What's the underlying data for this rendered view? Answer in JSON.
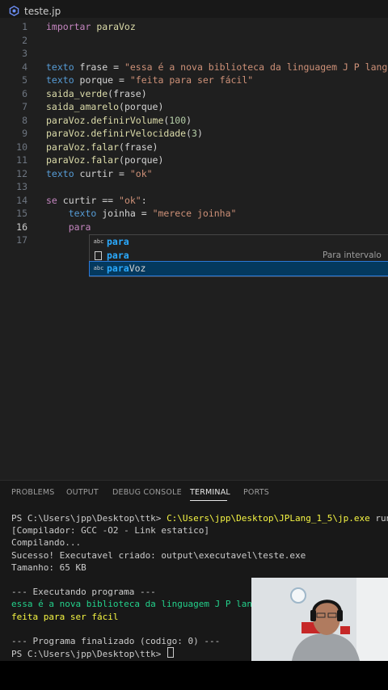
{
  "tab": {
    "title": "teste.jp",
    "icon": "file-gear-icon"
  },
  "editor": {
    "active_line": 16,
    "lines": [
      {
        "n": "1",
        "tokens": [
          {
            "t": "importar",
            "c": "kw"
          },
          {
            "t": " paraVoz",
            "c": "fn"
          }
        ]
      },
      {
        "n": "2",
        "tokens": []
      },
      {
        "n": "3",
        "tokens": []
      },
      {
        "n": "4",
        "tokens": [
          {
            "t": "texto",
            "c": "ty"
          },
          {
            "t": " frase = ",
            "c": "vr"
          },
          {
            "t": "\"essa é a nova biblioteca da linguagem J P lang\"",
            "c": "st"
          }
        ]
      },
      {
        "n": "5",
        "tokens": [
          {
            "t": "texto",
            "c": "ty"
          },
          {
            "t": " porque = ",
            "c": "vr"
          },
          {
            "t": "\"feita para ser fácil\"",
            "c": "st"
          }
        ]
      },
      {
        "n": "6",
        "tokens": [
          {
            "t": "saida_verde",
            "c": "fn"
          },
          {
            "t": "(frase)",
            "c": "vr"
          }
        ]
      },
      {
        "n": "7",
        "tokens": [
          {
            "t": "saida_amarelo",
            "c": "fn"
          },
          {
            "t": "(porque)",
            "c": "vr"
          }
        ]
      },
      {
        "n": "8",
        "tokens": [
          {
            "t": "paraVoz.definirVolume",
            "c": "fn"
          },
          {
            "t": "(",
            "c": "vr"
          },
          {
            "t": "100",
            "c": "nu"
          },
          {
            "t": ")",
            "c": "vr"
          }
        ]
      },
      {
        "n": "9",
        "tokens": [
          {
            "t": "paraVoz.definirVelocidade",
            "c": "fn"
          },
          {
            "t": "(",
            "c": "vr"
          },
          {
            "t": "3",
            "c": "nu"
          },
          {
            "t": ")",
            "c": "vr"
          }
        ]
      },
      {
        "n": "10",
        "tokens": [
          {
            "t": "paraVoz.falar",
            "c": "fn"
          },
          {
            "t": "(frase)",
            "c": "vr"
          }
        ]
      },
      {
        "n": "11",
        "tokens": [
          {
            "t": "paraVoz.falar",
            "c": "fn"
          },
          {
            "t": "(porque)",
            "c": "vr"
          }
        ]
      },
      {
        "n": "12",
        "tokens": [
          {
            "t": "texto",
            "c": "ty"
          },
          {
            "t": " curtir = ",
            "c": "vr"
          },
          {
            "t": "\"ok\"",
            "c": "st"
          }
        ]
      },
      {
        "n": "13",
        "tokens": []
      },
      {
        "n": "14",
        "tokens": [
          {
            "t": "se",
            "c": "kw"
          },
          {
            "t": " curtir == ",
            "c": "vr"
          },
          {
            "t": "\"ok\"",
            "c": "st"
          },
          {
            "t": ":",
            "c": "vr"
          }
        ]
      },
      {
        "n": "15",
        "tokens": [
          {
            "t": "    ",
            "c": "vr"
          },
          {
            "t": "texto",
            "c": "ty"
          },
          {
            "t": " joinha = ",
            "c": "vr"
          },
          {
            "t": "\"merece joinha\"",
            "c": "st"
          }
        ]
      },
      {
        "n": "16",
        "tokens": [
          {
            "t": "    ",
            "c": "vr"
          },
          {
            "t": "para",
            "c": "kw"
          }
        ]
      },
      {
        "n": "17",
        "tokens": []
      }
    ]
  },
  "suggestions": [
    {
      "icon": "abc",
      "icon_name": "text-word-icon",
      "label": "para",
      "match": "para",
      "rest": "",
      "detail": ""
    },
    {
      "icon": "box",
      "icon_name": "snippet-icon",
      "label": "para",
      "match": "para",
      "rest": "",
      "detail": "Para intervalo"
    },
    {
      "icon": "abc",
      "icon_name": "text-word-icon",
      "label": "paraVoz",
      "match": "para",
      "rest": "Voz",
      "detail": ""
    }
  ],
  "panel_tabs": [
    "PROBLEMS",
    "OUTPUT",
    "DEBUG CONSOLE",
    "TERMINAL",
    "PORTS"
  ],
  "active_panel_tab": "TERMINAL",
  "terminal": {
    "lines": [
      {
        "prompt": "PS C:\\Users\\jpp\\Desktop\\ttk> ",
        "cmd": "C:\\Users\\jpp\\Desktop\\JPLang_1_5\\jp.exe",
        "args": " run teste.jp"
      },
      {
        "text": "[Compilador: GCC -O2 - Link estatico]",
        "c": ""
      },
      {
        "text": "Compilando...",
        "c": ""
      },
      {
        "text": "Sucesso! Executavel criado: output\\executavel\\teste.exe",
        "c": ""
      },
      {
        "text": "Tamanho: 65 KB",
        "c": ""
      },
      {
        "text": "",
        "c": ""
      },
      {
        "text": "--- Executando programa ---",
        "c": ""
      },
      {
        "text": "essa é a nova biblioteca da linguagem J P lang",
        "c": "tgreen"
      },
      {
        "text": "feita para ser fácil",
        "c": "tyellow"
      },
      {
        "text": "",
        "c": ""
      },
      {
        "text": "--- Programa finalizado (codigo: 0) ---",
        "c": ""
      },
      {
        "prompt": "PS C:\\Users\\jpp\\Desktop\\ttk> ",
        "cursor": true
      }
    ]
  },
  "colors": {
    "editor_bg": "#1f1f1f",
    "keyword": "#c586c0",
    "type": "#569cd6",
    "function": "#dcdcaa",
    "string": "#ce9178",
    "number": "#b5cea8",
    "suggest_selected": "#04395e",
    "terminal_green": "#23d18b",
    "terminal_yellow": "#f5f543"
  }
}
